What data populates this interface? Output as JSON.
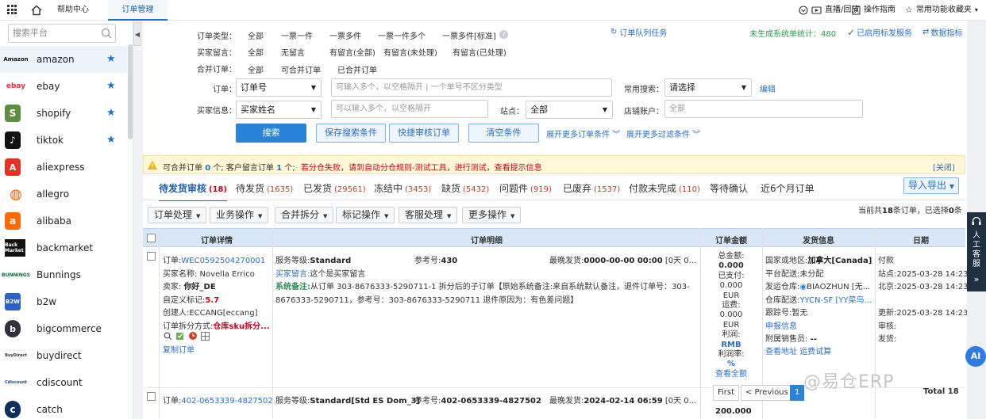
{
  "topbar": {
    "help_tab": "帮助中心",
    "order_tab": "订单管理",
    "live": "直播/回放",
    "guide": "操作指南",
    "favorites": "常用功能收藏夹"
  },
  "sidebar": {
    "search_placeholder": "搜索平台",
    "platforms": [
      {
        "name": "amazon",
        "logo": "Amazon",
        "star": true
      },
      {
        "name": "ebay",
        "logo": "ebay",
        "star": true
      },
      {
        "name": "shopify",
        "logo": "S",
        "star": true
      },
      {
        "name": "tiktok",
        "logo": "♪",
        "star": true
      },
      {
        "name": "aliexpress",
        "logo": "A",
        "star": false
      },
      {
        "name": "allegro",
        "logo": "◍",
        "star": false
      },
      {
        "name": "alibaba",
        "logo": "a",
        "star": false
      },
      {
        "name": "backmarket",
        "logo": "Back Market",
        "star": false
      },
      {
        "name": "Bunnings",
        "logo": "BUNNINGS",
        "star": false
      },
      {
        "name": "b2w",
        "logo": "B2W",
        "star": false
      },
      {
        "name": "bigcommerce",
        "logo": "b",
        "star": false
      },
      {
        "name": "buydirect",
        "logo": "BuyDirect",
        "star": false
      },
      {
        "name": "cdiscount",
        "logo": "Cdiscount",
        "star": false
      },
      {
        "name": "catch",
        "logo": "c",
        "star": false
      }
    ]
  },
  "filters": {
    "order_type_label": "订单类型：",
    "order_type_opts": [
      "全部",
      "一票一件",
      "一票多件",
      "一票一件多个",
      "一票多件[标准]"
    ],
    "buyer_msg_label": "买家留言：",
    "buyer_msg_opts": [
      "全部",
      "无留言",
      "有留言(全部)",
      "有留言(未处理)",
      "有留言(已处理)"
    ],
    "merge_label": "合并订单：",
    "merge_opts": [
      "全部",
      "可合并订单",
      "已合并订单"
    ],
    "order_label": "订单：",
    "order_select": "订单号",
    "order_input_ph": "可输入多个，以空格隔开 | 一个单号不区分类型",
    "common_search_label": "常用搜索：",
    "common_search_select": "请选择",
    "edit_link": "编辑",
    "buyer_info_label": "买家信息：",
    "buyer_select": "买家姓名",
    "buyer_input_ph": "可以输入多个，以空格隔开",
    "site_label": "站点：",
    "site_select": "全部",
    "shop_label": "店铺账户：",
    "shop_input_ph": "全部",
    "queue_link": "订单队列任务",
    "unsent_stat": "未生成系统单统计：480",
    "enabled_link": "已启用标发服务",
    "metrics_link": "数据指标",
    "search_btn": "搜索",
    "save_btn": "保存搜索条件",
    "quick_btn": "快捷审核订单",
    "clear_btn": "清空条件",
    "more_order": "展开更多订单条件",
    "more_filter": "展开更多过滤条件"
  },
  "warning": {
    "prefix": "可合并订单",
    "mergeable": "0",
    "mid": "个; 客户留言订单",
    "msg_count": "1",
    "suffix": "个;",
    "alert": "若分仓失败，请到自动分仓规则-测试工具，进行测试，查看提示信息",
    "close": "[关闭]"
  },
  "status_tabs": [
    {
      "label": "待发货审核",
      "count": "(18)"
    },
    {
      "label": "待发货",
      "count": "(1635)"
    },
    {
      "label": "已发货",
      "count": "(29561)"
    },
    {
      "label": "冻结中",
      "count": "(3453)"
    },
    {
      "label": "缺货",
      "count": "(5432)"
    },
    {
      "label": "问题件",
      "count": "(919)"
    },
    {
      "label": "已废弃",
      "count": "(1537)"
    },
    {
      "label": "付款未完成",
      "count": "(110)"
    },
    {
      "label": "等待确认",
      "count": ""
    },
    {
      "label": "近6个月订单",
      "count": ""
    }
  ],
  "import_export": "导入导出",
  "actions": [
    "订单处理",
    "业务操作",
    "合并拆分",
    "标记操作",
    "客服处理",
    "更多操作"
  ],
  "summary": {
    "prefix": "当前共",
    "total": "18",
    "mid": "条订单，已选择",
    "selected": "0",
    "suffix": "条"
  },
  "table": {
    "headers": [
      "订单详情",
      "订单明细",
      "订单金额",
      "发货信息",
      "日期"
    ]
  },
  "row1": {
    "order_label": "订单:",
    "order_no": "WEC0592504270001",
    "buyer": "买家名称: Novella Errico",
    "seller_label": "卖家:",
    "seller": "你好_DE",
    "custom_label": "自定义标记:",
    "custom": "5.7",
    "creator": "创建人:ECCANG[eccang]",
    "split_label": "订单拆分方式:",
    "split": "仓库sku拆分...",
    "copy": "复制订单",
    "service_label": "服务等级:",
    "service": "Standard",
    "ref_label": "参考号:",
    "ref": "430",
    "latest_label": "最晚发货:",
    "latest": "0000-00-00 00:00",
    "latest_tail": "[0天 0...",
    "buyer_msg_label": "买家留言:",
    "buyer_msg": "这个是买家留言",
    "sys_label": "系统备注:",
    "sys_line1": "从订单 303-8676333-5290711-1 拆分后的子订单【原始系统备注:来自系统默认备注，退件订单号：303-",
    "sys_line2": "8676333-5290711，参考号：303-8676333-5290711 退件原因为：有色差问题】",
    "amounts": [
      "总金额:",
      "0.000",
      "已支付:",
      "0.000",
      "EUR",
      "运费:",
      "0.000",
      "EUR",
      "利润:",
      "RMB",
      "利润率:",
      "%",
      "查看全额"
    ],
    "country_label": "国家或地区:",
    "country": "加拿大[Canada]",
    "platform_ship": "平台配送:未分配",
    "wh_label": "发运仓库:",
    "wh": "BIAOZHUN [无...",
    "wh_ship_label": "仓库配送:",
    "wh_ship": "YYCN-SF [YY菜鸟...",
    "track": "跟踪号:暂无",
    "apply": "申报信息",
    "sales_label": "附属销售员:",
    "sales": "--",
    "view_addr": "查看地址",
    "freight": "运费试算",
    "date_pay": "付款",
    "date_site": "站点:2025-03-28 14:23",
    "date_bj": "北京:2025-03-28 14:23",
    "date_upd": "更新:2025-03-28 14:23",
    "date_audit": "审核:",
    "date_ship": "发货:"
  },
  "row2": {
    "order_label": "订单:",
    "order_no": "402-0653339-4827502",
    "service_label": "服务等级:",
    "service": "Standard[Std ES Dom_3]",
    "ref_label": "参考号:",
    "ref": "402-0653339-4827502",
    "latest_label": "最晚发货:",
    "latest": "2024-02-14 06:59",
    "latest_tail": "[0天 0...",
    "amount": "200.000"
  },
  "pagination": {
    "first": "First",
    "prev": "< Previous",
    "current": "1",
    "total": "Total 18"
  },
  "rail": {
    "kf": "人工客服",
    "ai": "AI"
  },
  "watermark": "@易仓ERP"
}
